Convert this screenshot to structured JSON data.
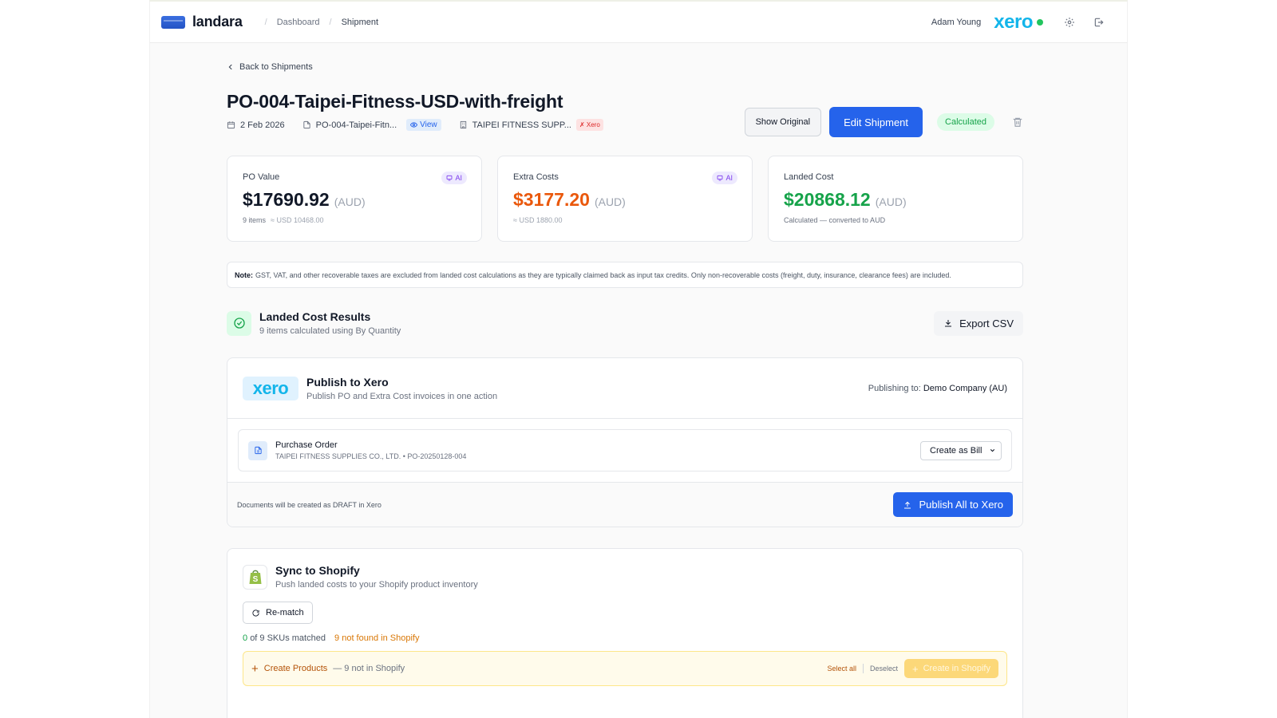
{
  "app": {
    "name": "landara",
    "brand_color": "#2563eb"
  },
  "breadcrumb": {
    "items": [
      "Dashboard",
      "Shipment"
    ]
  },
  "topbar": {
    "user_name": "Adam Young",
    "xero_label": "xero",
    "xero_status_color": "#22c55e"
  },
  "back_link": "Back to Shipments",
  "shipment": {
    "title": "PO-004-Taipei-Fitness-USD-with-freight",
    "date": "2 Feb 2026",
    "doc_name": "PO-004-Taipei-Fitn...",
    "view_label": "View",
    "supplier": "TAIPEI FITNESS SUPP...",
    "xero_tag": "✗ Xero"
  },
  "actions": {
    "show_original": "Show Original",
    "edit_shipment": "Edit Shipment",
    "status": "Calculated"
  },
  "cards": {
    "po_value": {
      "label": "PO Value",
      "ai": "AI",
      "value": "$17690.92",
      "currency": "(AUD)",
      "sub": "9 items",
      "sub_muted": "≈ USD 10468.00"
    },
    "extra_costs": {
      "label": "Extra Costs",
      "ai": "AI",
      "value": "$3177.20",
      "currency": "(AUD)",
      "sub": "≈ USD 1880.00"
    },
    "landed_cost": {
      "label": "Landed Cost",
      "value": "$20868.12",
      "currency": "(AUD)",
      "sub": "Calculated — converted to AUD"
    }
  },
  "note": {
    "label": "Note:",
    "text": "GST, VAT, and other recoverable taxes are excluded from landed cost calculations as they are typically claimed back as input tax credits. Only non-recoverable costs (freight, duty, insurance, clearance fees) are included."
  },
  "results": {
    "title": "Landed Cost Results",
    "subtitle": "9 items calculated using By Quantity",
    "export_label": "Export CSV"
  },
  "xero_panel": {
    "logo": "xero",
    "title": "Publish to Xero",
    "subtitle": "Publish PO and Extra Cost invoices in one action",
    "publishing_to_label": "Publishing to:",
    "company": "Demo Company (AU)",
    "po_row": {
      "title": "Purchase Order",
      "subtitle": "TAIPEI FITNESS SUPPLIES CO., LTD. • PO-20250128-004",
      "select_value": "Create as Bill"
    },
    "footer_note": "Documents will be created as DRAFT in Xero",
    "publish_label": "Publish All to Xero"
  },
  "shopify_panel": {
    "title": "Sync to Shopify",
    "subtitle": "Push landed costs to your Shopify product inventory",
    "rematch_label": "Re-match",
    "matched_count": "0",
    "matched_text": "of 9 SKUs matched",
    "not_found_text": "9 not found in Shopify",
    "create_products_label": "Create Products",
    "create_products_count": "— 9 not in Shopify",
    "select_all": "Select all",
    "deselect": "Deselect",
    "create_in_shopify": "Create in Shopify"
  }
}
